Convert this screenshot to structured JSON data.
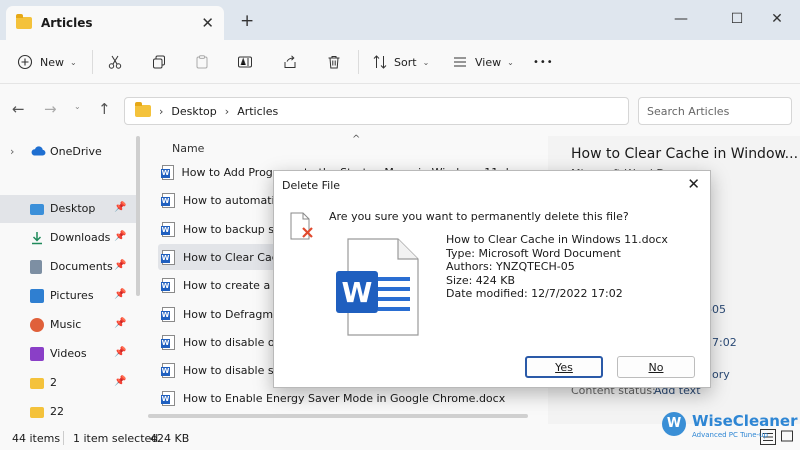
{
  "window": {
    "tab_title": "Articles",
    "tab_close": "✕",
    "new_tab": "+",
    "minimize": "—",
    "maximize": "☐",
    "close": "✕"
  },
  "toolbar": {
    "new_label": "New",
    "sort_label": "Sort",
    "view_label": "View",
    "more": "•••"
  },
  "address": {
    "crumbs": [
      "Desktop",
      "Articles"
    ],
    "search_placeholder": "Search Articles"
  },
  "nav": {
    "items": [
      {
        "label": "OneDrive",
        "icon": "cloud-icon",
        "pinned": false
      },
      {
        "label": "Desktop",
        "icon": "desktop-icon",
        "pinned": true
      },
      {
        "label": "Downloads",
        "icon": "download-icon",
        "pinned": true
      },
      {
        "label": "Documents",
        "icon": "documents-icon",
        "pinned": true
      },
      {
        "label": "Pictures",
        "icon": "pictures-icon",
        "pinned": true
      },
      {
        "label": "Music",
        "icon": "music-icon",
        "pinned": true
      },
      {
        "label": "Videos",
        "icon": "videos-icon",
        "pinned": true
      },
      {
        "label": "2",
        "icon": "folder-icon",
        "pinned": true
      },
      {
        "label": "22",
        "icon": "folder-icon",
        "pinned": false
      }
    ]
  },
  "files": {
    "column_name": "Name",
    "rows": [
      "How to Add Programs to the Startup Menu in Windows 11.docx",
      "How to automatically",
      "How to backup sys",
      "How to Clear Cache",
      "How to create a dis",
      "How to Defragmen",
      "How to disable or r",
      "How to disable syst",
      "How to Enable Energy Saver Mode in Google Chrome.docx"
    ],
    "selected_index": 3
  },
  "preview": {
    "title": "How to Clear Cache in Window...",
    "type": "Microsoft Word Docum",
    "values": [
      "-05",
      "7:02",
      "ory"
    ],
    "content_status_label": "Content status:",
    "add_text": "Add text"
  },
  "status": {
    "item_count": "44 items",
    "selection": "1 item selected",
    "size": "424 KB"
  },
  "watermark": {
    "logo": "W",
    "name": "WiseCleaner",
    "sub": "Advanced PC Tune-up"
  },
  "dialog": {
    "title": "Delete File",
    "question": "Are you sure you want to permanently delete this file?",
    "file_name": "How to Clear Cache in Windows 11.docx",
    "type": "Type: Microsoft Word Document",
    "authors": "Authors: YNZQTECH-05",
    "size": "Size: 424 KB",
    "date_modified": "Date modified: 12/7/2022 17:02",
    "yes": "Yes",
    "no": "No"
  },
  "colors": {
    "accent": "#2b5aa8",
    "word_blue": "#1f5fbf",
    "folder": "#f4c23b",
    "selection": "#e2e4e8"
  }
}
